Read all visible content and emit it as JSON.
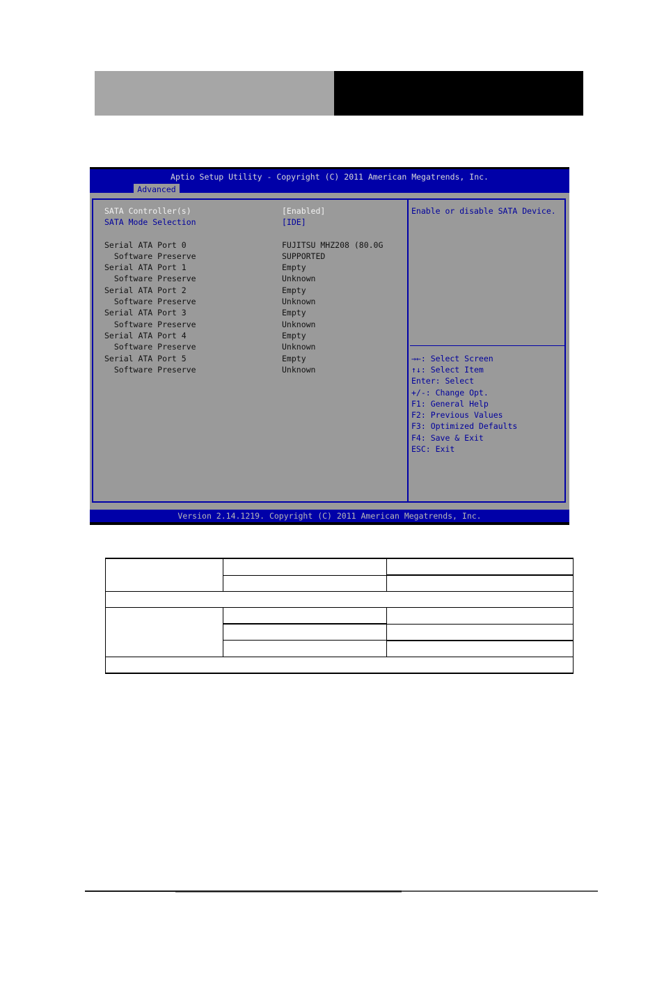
{
  "bios": {
    "title": "Aptio Setup Utility - Copyright (C) 2011 American Megatrends, Inc.",
    "active_tab": "Advanced",
    "footer": "Version 2.14.1219. Copyright (C) 2011 American Megatrends, Inc.",
    "settings": [
      {
        "label": "SATA Controller(s)",
        "value": "[Enabled]",
        "style": "white"
      },
      {
        "label": "SATA Mode Selection",
        "value": "[IDE]",
        "style": "selected"
      },
      {
        "label": "Serial ATA Port 0",
        "value": "FUJITSU MHZ208 (80.0G",
        "style": "info"
      },
      {
        "label": "  Software Preserve",
        "value": "SUPPORTED",
        "style": "info"
      },
      {
        "label": "Serial ATA Port 1",
        "value": "Empty",
        "style": "info"
      },
      {
        "label": "  Software Preserve",
        "value": "Unknown",
        "style": "info"
      },
      {
        "label": "Serial ATA Port 2",
        "value": "Empty",
        "style": "info"
      },
      {
        "label": "  Software Preserve",
        "value": "Unknown",
        "style": "info"
      },
      {
        "label": "Serial ATA Port 3",
        "value": "Empty",
        "style": "info"
      },
      {
        "label": "  Software Preserve",
        "value": "Unknown",
        "style": "info"
      },
      {
        "label": "Serial ATA Port 4",
        "value": "Empty",
        "style": "info"
      },
      {
        "label": "  Software Preserve",
        "value": "Unknown",
        "style": "info"
      },
      {
        "label": "Serial ATA Port 5",
        "value": "Empty",
        "style": "info"
      },
      {
        "label": "  Software Preserve",
        "value": "Unknown",
        "style": "info"
      }
    ],
    "help_text": "Enable or disable SATA Device.",
    "key_help": [
      "→←: Select Screen",
      "↑↓: Select Item",
      "Enter: Select",
      "+/-: Change Opt.",
      "F1: General Help",
      "F2: Previous Values",
      "F3: Optimized Defaults",
      "F4: Save & Exit",
      "ESC: Exit"
    ]
  },
  "colors": {
    "bios_blue": "#0000a8",
    "bios_gray": "#9a9a9a",
    "selected_text": "#00009c",
    "header_gray": "#a6a6a6",
    "header_black": "#000000"
  }
}
